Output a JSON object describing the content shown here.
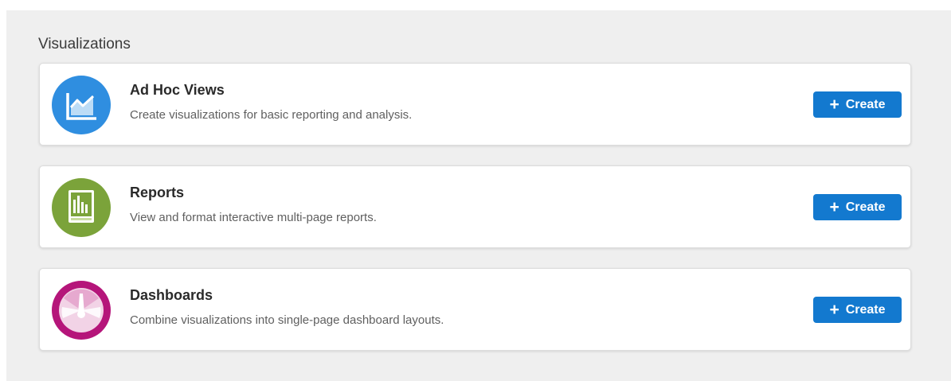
{
  "section": {
    "title": "Visualizations"
  },
  "cards": [
    {
      "title": "Ad Hoc Views",
      "description": "Create visualizations for basic reporting and analysis.",
      "icon": "line-chart-icon",
      "icon_color": "#2f8ee0",
      "button_label": "Create",
      "button_icon": "+"
    },
    {
      "title": "Reports",
      "description": "View and format interactive multi-page reports.",
      "icon": "report-bar-chart-icon",
      "icon_color": "#7ba33a",
      "button_label": "Create",
      "button_icon": "+"
    },
    {
      "title": "Dashboards",
      "description": "Combine visualizations into single-page dashboard layouts.",
      "icon": "gauge-icon",
      "icon_color": "#b5157a",
      "button_label": "Create",
      "button_icon": "+"
    }
  ],
  "colors": {
    "button_bg": "#1379cf",
    "panel_bg": "#efefef"
  }
}
